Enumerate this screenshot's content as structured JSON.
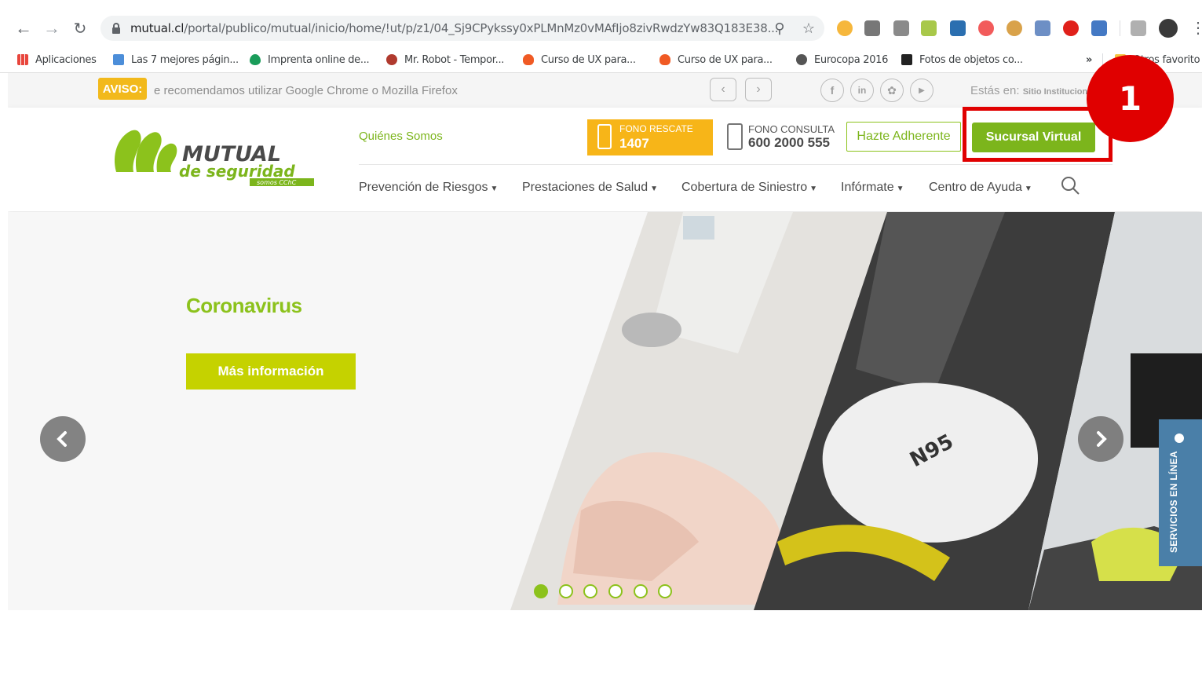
{
  "browser": {
    "url_host": "mutual.cl",
    "url_path": "/portal/publico/mutual/inicio/home/!ut/p/z1/04_Sj9CPykssy0xPLMnMz0vMAfIjo8zivRwdzYw83Q183E38...",
    "bookmarks": [
      {
        "label": "Aplicaciones",
        "color": "#e8453c"
      },
      {
        "label": "Las 7 mejores págin...",
        "color": "#4c8ed9"
      },
      {
        "label": "Imprenta online de...",
        "color": "#1a9c5a"
      },
      {
        "label": "Mr. Robot - Tempor...",
        "color": "#b03a2e"
      },
      {
        "label": "Curso de UX para...",
        "color": "#f05a24"
      },
      {
        "label": "Curso de UX para...",
        "color": "#f05a24"
      },
      {
        "label": "Eurocopa 2016",
        "color": "#555555"
      },
      {
        "label": "Fotos de objetos co...",
        "color": "#222222"
      }
    ],
    "more_bookmarks": "»",
    "other_bookmarks": "Otros favorito"
  },
  "site": {
    "aviso_badge": "AVISO:",
    "aviso_text": "e recomendamos utilizar Google Chrome o Mozilla Firefox",
    "estas_en_label": "Estás en:",
    "estas_en_value": "Sitio Institucion",
    "logo_line1": "MUTUAL",
    "logo_line2": "de seguridad",
    "logo_line3": "somos CChC",
    "quienes_somos": "Quiénes Somos",
    "fono_rescate_label": "FONO RESCATE",
    "fono_rescate_number": "1407",
    "fono_consulta_label": "FONO CONSULTA",
    "fono_consulta_number": "600 2000 555",
    "hazte_adherente": "Hazte Adherente",
    "sucursal_virtual": "Sucursal Virtual",
    "nav": [
      "Prevención de Riesgos",
      "Prestaciones de Salud",
      "Cobertura de Siniestro",
      "Infórmate",
      "Centro de Ayuda"
    ],
    "hero_title": "Coronavirus",
    "hero_button": "Más información",
    "carousel_total": 6,
    "carousel_active": 1,
    "servicios_tab": "SERVICIOS EN LÍNEA",
    "mask_text": "N95"
  },
  "annotation": {
    "badge": "1",
    "color": "#e00000"
  },
  "colors": {
    "brand_green": "#7cb51c",
    "rescate_orange": "#f7b518",
    "aviso_yellow": "#f2b91b",
    "hero_button": "#c5d200",
    "servicios_blue": "#4a7fa8"
  }
}
